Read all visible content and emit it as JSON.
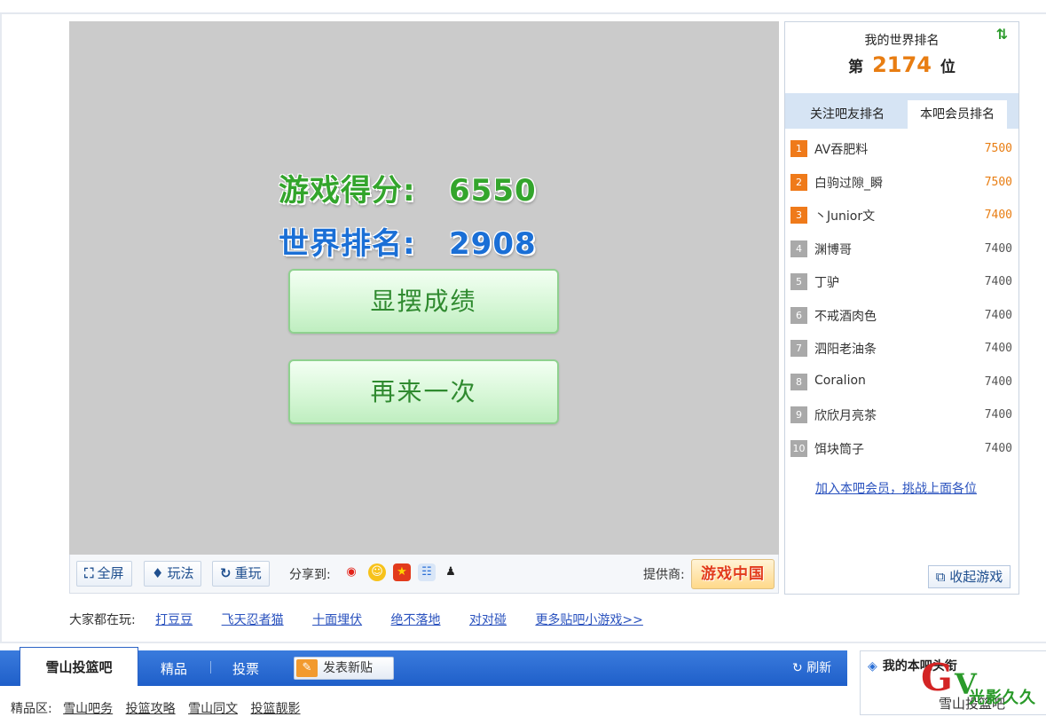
{
  "game": {
    "score_label": "游戏得分:",
    "score_value": "6550",
    "world_rank_label": "世界排名:",
    "world_rank_value": "2908",
    "show_button": "显摆成绩",
    "again_button": "再来一次"
  },
  "toolbar": {
    "fullscreen": "全屏",
    "howto": "玩法",
    "replay": "重玩",
    "share_label": "分享到:",
    "share_icons": [
      "weibo-icon",
      "smile-icon",
      "star-icon",
      "kaixin-icon",
      "qq-icon"
    ],
    "provider_label": "提供商:",
    "provider_name": "游戏中国"
  },
  "playing": {
    "label": "大家都在玩:",
    "games": [
      "打豆豆",
      "飞天忍者猫",
      "十面埋伏",
      "绝不落地",
      "对对碰",
      "更多贴吧小游戏>>"
    ]
  },
  "rank_panel": {
    "title": "我的世界排名",
    "rank_prefix": "第",
    "rank_number": "2174",
    "rank_suffix": "位",
    "tab_friends": "关注吧友排名",
    "tab_members": "本吧会员排名",
    "rows": [
      {
        "rank": "1",
        "name": "AV吞肥料",
        "score": "7500"
      },
      {
        "rank": "2",
        "name": "白驹过隙_瞬",
        "score": "7500"
      },
      {
        "rank": "3",
        "name": "丶Junior文",
        "score": "7400"
      },
      {
        "rank": "4",
        "name": "渊博哥",
        "score": "7400"
      },
      {
        "rank": "5",
        "name": "丁驴",
        "score": "7400"
      },
      {
        "rank": "6",
        "name": "不戒酒肉色",
        "score": "7400"
      },
      {
        "rank": "7",
        "name": "泗阳老油条",
        "score": "7400"
      },
      {
        "rank": "8",
        "name": "Coralion",
        "score": "7400"
      },
      {
        "rank": "9",
        "name": "欣欣月亮茶",
        "score": "7400"
      },
      {
        "rank": "10",
        "name": "饵块筒子",
        "score": "7400"
      }
    ],
    "join_link": "加入本吧会员，挑战上面各位",
    "collapse_button": "收起游戏"
  },
  "forum_bar": {
    "active_tab": "雪山投篮吧",
    "tab_jingpin": "精品",
    "tab_vote": "投票",
    "post_button": "发表新贴",
    "refresh": "刷新"
  },
  "jingpin_row": {
    "label": "精品区:",
    "links": [
      "雪山吧务",
      "投篮攻略",
      "雪山同文",
      "投篮靓影"
    ]
  },
  "side_box": {
    "title": "我的本吧头衔",
    "subtitle": "雪山投篮吧"
  },
  "watermark": {
    "g": "G",
    "v": "V",
    "text": "光影久久"
  },
  "colors": {
    "score_green": "#33a52c",
    "rank_blue": "#1a6fd6",
    "accent_orange": "#e87d12",
    "forum_blue": "#1f5fc9",
    "link_blue": "#2a52be"
  }
}
